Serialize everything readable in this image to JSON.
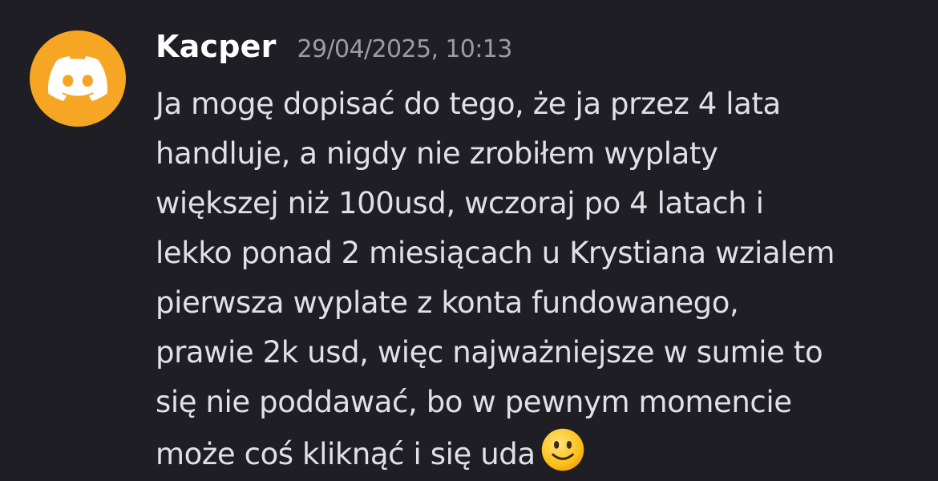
{
  "message": {
    "author": "Kacper",
    "timestamp": "29/04/2025, 10:13",
    "avatar_icon": "discord-logo-icon",
    "avatar_color": "#f6a623",
    "lines": [
      "Ja mogę dopisać do tego, że ja przez 4 lata",
      "handluje, a nigdy nie zrobiłem wyplaty",
      "większej niż 100usd, wczoraj po 4 latach i",
      "lekko ponad 2 miesiącach u Krystiana wzialem",
      "pierwsza wyplate z konta fundowanego,",
      "prawie 2k usd, więc najważniejsze w sumie to",
      "się nie poddawać, bo w pewnym momencie",
      "może coś kliknąć i się uda"
    ],
    "emoji_icon": "slightly-smiling-face-icon"
  },
  "colors": {
    "background": "#1e1e24",
    "username": "#ffffff",
    "timestamp": "#9a9ca3",
    "text": "#e0e1e5"
  }
}
